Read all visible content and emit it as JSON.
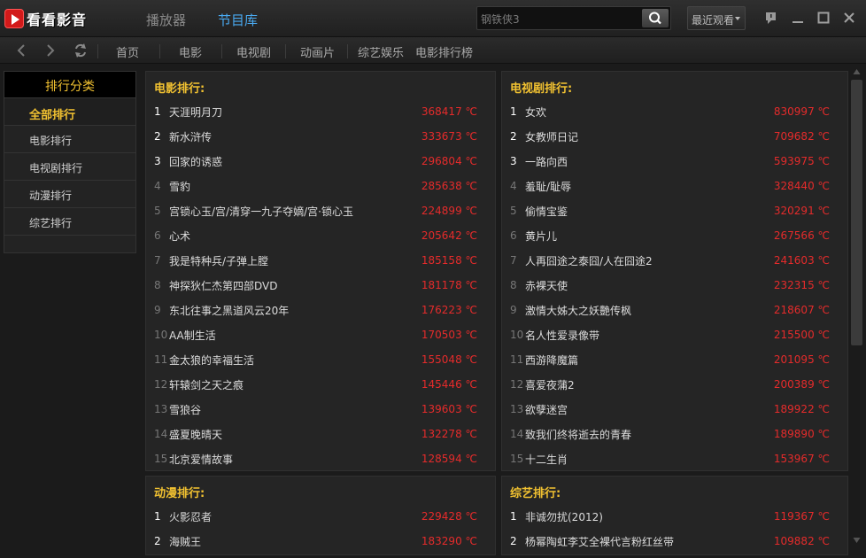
{
  "app": {
    "logo_text": "看看影音"
  },
  "top_tabs": [
    {
      "label": "播放器"
    },
    {
      "label": "节目库"
    }
  ],
  "search": {
    "value": "钢铁侠3"
  },
  "recent": {
    "label": "最近观看"
  },
  "nav": {
    "items": [
      "首页",
      "电影",
      "电视剧",
      "动画片",
      "综艺娱乐",
      "电影排行榜"
    ]
  },
  "sidebar": {
    "header": "排行分类",
    "items": [
      "全部排行",
      "电影排行",
      "电视剧排行",
      "动漫排行",
      "综艺排行"
    ]
  },
  "unit": "℃",
  "colors": {
    "accent": "#f2c231",
    "heat": "#e52b2b",
    "tab_active": "#49a9f0",
    "logo": "#d21a1a"
  },
  "panels": {
    "movie": {
      "title": "电影排行:",
      "rows": [
        {
          "rank": "1",
          "title": "天涯明月刀",
          "heat": "368417 ℃"
        },
        {
          "rank": "2",
          "title": "新水浒传",
          "heat": "333673 ℃"
        },
        {
          "rank": "3",
          "title": "回家的诱惑",
          "heat": "296804 ℃"
        },
        {
          "rank": "4",
          "title": "雪豹",
          "heat": "285638 ℃"
        },
        {
          "rank": "5",
          "title": "宫锁心玉/宫/清穿一九子夺嫡/宫·锁心玉",
          "heat": "224899 ℃"
        },
        {
          "rank": "6",
          "title": "心术",
          "heat": "205642 ℃"
        },
        {
          "rank": "7",
          "title": "我是特种兵/子弹上膛",
          "heat": "185158 ℃"
        },
        {
          "rank": "8",
          "title": "神探狄仁杰第四部DVD",
          "heat": "181178 ℃"
        },
        {
          "rank": "9",
          "title": "东北往事之黑道风云20年",
          "heat": "176223 ℃"
        },
        {
          "rank": "10",
          "title": "AA制生活",
          "heat": "170503 ℃"
        },
        {
          "rank": "11",
          "title": "金太狼的幸福生活",
          "heat": "155048 ℃"
        },
        {
          "rank": "12",
          "title": "轩辕剑之天之痕",
          "heat": "145446 ℃"
        },
        {
          "rank": "13",
          "title": "雪狼谷",
          "heat": "139603 ℃"
        },
        {
          "rank": "14",
          "title": "盛夏晚晴天",
          "heat": "132278 ℃"
        },
        {
          "rank": "15",
          "title": "北京爱情故事",
          "heat": "128594 ℃"
        }
      ]
    },
    "tv": {
      "title": "电视剧排行:",
      "rows": [
        {
          "rank": "1",
          "title": "女欢",
          "heat": "830997 ℃"
        },
        {
          "rank": "2",
          "title": "女教师日记",
          "heat": "709682 ℃"
        },
        {
          "rank": "3",
          "title": "一路向西",
          "heat": "593975 ℃"
        },
        {
          "rank": "4",
          "title": "羞耻/耻辱",
          "heat": "328440 ℃"
        },
        {
          "rank": "5",
          "title": "偷情宝鉴",
          "heat": "320291 ℃"
        },
        {
          "rank": "6",
          "title": "黄片儿",
          "heat": "267566 ℃"
        },
        {
          "rank": "7",
          "title": "人再囧途之泰囧/人在囧途2",
          "heat": "241603 ℃"
        },
        {
          "rank": "8",
          "title": "赤裸天使",
          "heat": "232315 ℃"
        },
        {
          "rank": "9",
          "title": "激情大姊大之妖艷传枫",
          "heat": "218607 ℃"
        },
        {
          "rank": "10",
          "title": "名人性爱录像带",
          "heat": "215500 ℃"
        },
        {
          "rank": "11",
          "title": "西游降魔篇",
          "heat": "201095 ℃"
        },
        {
          "rank": "12",
          "title": "喜爱夜蒲2",
          "heat": "200389 ℃"
        },
        {
          "rank": "13",
          "title": "欲孽迷宫",
          "heat": "189922 ℃"
        },
        {
          "rank": "14",
          "title": "致我们终将逝去的青春",
          "heat": "189890 ℃"
        },
        {
          "rank": "15",
          "title": "十二生肖",
          "heat": "153967 ℃"
        }
      ]
    },
    "anime": {
      "title": "动漫排行:",
      "rows": [
        {
          "rank": "1",
          "title": "火影忍者",
          "heat": "229428 ℃"
        },
        {
          "rank": "2",
          "title": "海贼王",
          "heat": "183290 ℃"
        }
      ]
    },
    "variety": {
      "title": "综艺排行:",
      "rows": [
        {
          "rank": "1",
          "title": "非诚勿扰(2012)",
          "heat": "119367 ℃"
        },
        {
          "rank": "2",
          "title": "杨幂陶虹李艾全裸代言粉红丝带",
          "heat": "109882 ℃"
        }
      ]
    }
  }
}
